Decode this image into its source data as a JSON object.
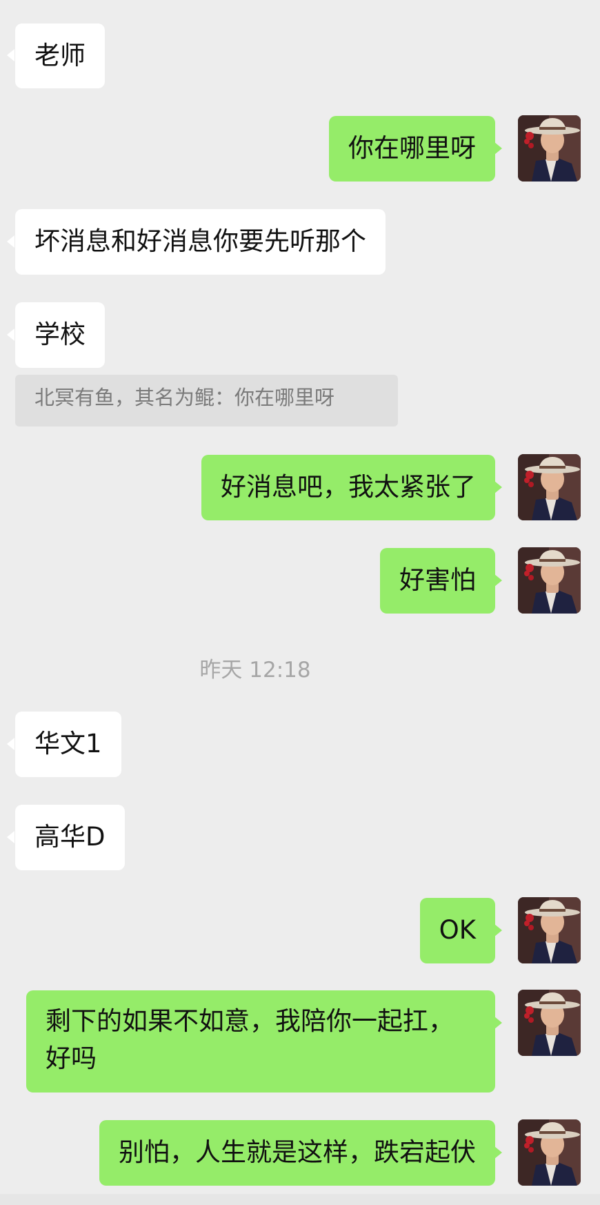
{
  "messages": [
    {
      "from": "other",
      "text": "老师"
    },
    {
      "from": "self",
      "text": "你在哪里呀"
    },
    {
      "from": "other",
      "text": "坏消息和好消息你要先听那个"
    },
    {
      "from": "other",
      "text": "学校",
      "quote": "北冥有鱼，其名为鲲：你在哪里呀"
    },
    {
      "from": "self",
      "text": "好消息吧，我太紧张了"
    },
    {
      "from": "self",
      "text": "好害怕"
    },
    {
      "from": "other",
      "text": "华文1"
    },
    {
      "from": "other",
      "text": "高华D"
    },
    {
      "from": "self",
      "text": "OK"
    },
    {
      "from": "self",
      "text": "剩下的如果不如意，我陪你一起扛，好吗"
    },
    {
      "from": "self",
      "text": "别怕，人生就是这样，跌宕起伏"
    }
  ],
  "timestamp": "昨天 12:18",
  "avatar_icon": "user-avatar-cowboy-hat",
  "colors": {
    "background": "#ededed",
    "incoming_bubble": "#ffffff",
    "outgoing_bubble": "#95ec69",
    "quote_bg": "#dfdfdf",
    "timestamp_text": "#a6a6a6"
  }
}
